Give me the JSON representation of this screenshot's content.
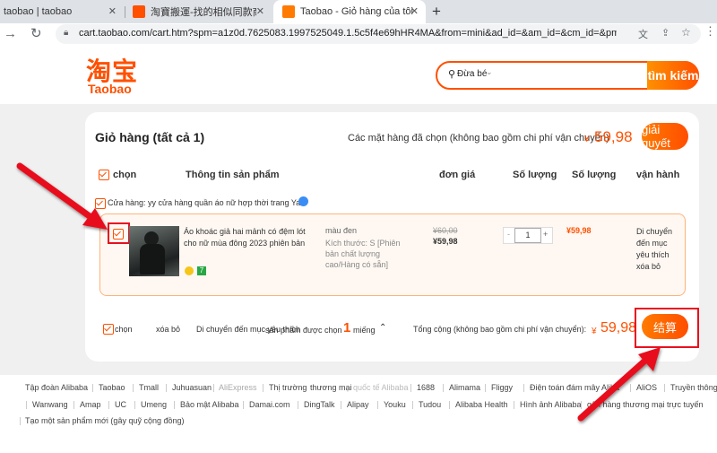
{
  "browser": {
    "tabs": [
      {
        "title": "taobao | taobao"
      },
      {
        "title": "淘寶搬運-找的相似同款商品更…"
      },
      {
        "title": "Taobao - Giỏ hàng của tôi"
      }
    ],
    "new_tab": "+",
    "url": "cart.taobao.com/cart.htm?spm=a1z0d.7625083.1997525049.1.5c5f4e69hHR4MA&from=mini&ad_id=&am_id=&cm_id=&pm_id=1501036000..."
  },
  "header": {
    "logo_cn": "淘宝",
    "logo_en": "Taobao",
    "search_scope": "Đừa bé",
    "search_button": "tìm kiếm"
  },
  "cart": {
    "title": "Giỏ hàng (tất cả 1)",
    "selected_summary": "Các mặt hàng đã chọn (không bao gồm chi phí vận chuyển)",
    "currency": "¥",
    "selected_total": "59,98",
    "settle_button": "giải quyết",
    "columns": {
      "select": "chọn",
      "info": "Thông tin sản phẩm",
      "unit_price": "đơn giá",
      "quantity": "Số lượng",
      "amount": "Số lượng",
      "operation": "vận hành"
    },
    "store": {
      "label": "Cửa hàng: yy cửa hàng quần áo nữ hợp thời trang Yan"
    },
    "item": {
      "name": "Áo khoác giả hai mảnh có đệm lót cho nữ mùa đông 2023 phiên bản",
      "color": "màu đen",
      "size": "Kích thước: S [Phiên bản chất lượng cao/Hàng có sẵn]",
      "original_price": "¥60,00",
      "price": "¥59,98",
      "qty_minus": "-",
      "qty": "1",
      "qty_plus": "+",
      "subtotal": "¥59,98",
      "action": "Di chuyển đến mục yêu thích xóa bỏ"
    },
    "bottom": {
      "select": "chọn",
      "delete": "xóa bỏ",
      "move_fav": "Di chuyển đến mục yêu thích",
      "selected_count_prefix": "sản phẩm được chọn",
      "selected_count": "1",
      "selected_count_suffix": "miếng",
      "total_label": "Tổng cộng (không bao gồm chi phí vận chuyển):",
      "total": "59,98",
      "checkout_button": "结算"
    }
  },
  "footer": {
    "row1": [
      "Tập đoàn Alibaba",
      "Taobao",
      "Tmall",
      "Juhuasuan",
      "AliExpress",
      "Thị trường",
      "thương mại",
      "quốc tế Alibaba",
      "1688",
      "Alimama",
      "Fliggy",
      "Điện toán đám mây Aliba",
      "AliOS",
      "Truyền thông"
    ],
    "row2": [
      "Wanwang",
      "Amap",
      "UC",
      "Umeng",
      "Bảo mật Alibaba",
      "Damai.com",
      "DingTalk",
      "Alipay",
      "Youku",
      "Tudou",
      "Alibaba Health",
      "Hình ảnh Alibaba",
      "gân hàng thương mại trực tuyến"
    ],
    "row3": [
      "Tạo một sản phẩm mới (gây quỹ cộng đồng)"
    ]
  },
  "colors": {
    "accent": "#ff5000",
    "annotation": "#e8101e"
  }
}
